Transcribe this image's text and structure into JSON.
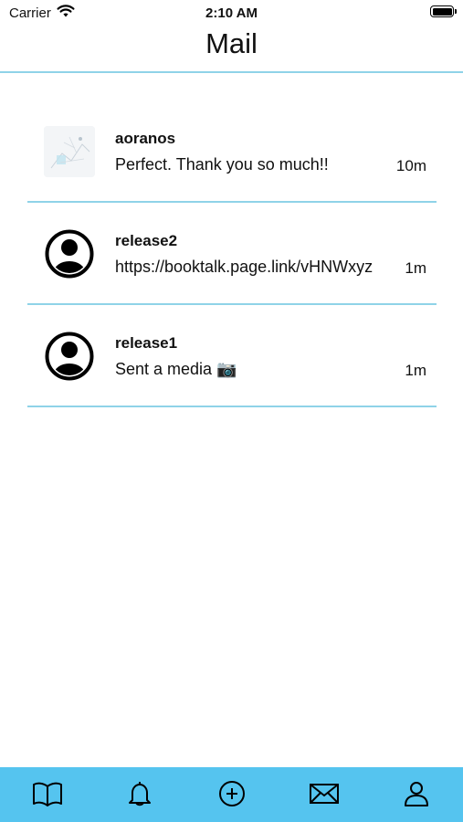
{
  "status_bar": {
    "carrier": "Carrier",
    "time": "2:10 AM"
  },
  "header": {
    "title": "Mail"
  },
  "conversations": [
    {
      "name": "aoranos",
      "preview": "Perfect. Thank you so much!!",
      "time": "10m",
      "avatar": "photo"
    },
    {
      "name": "release2",
      "preview": "https://booktalk.page.link/vHNWxyz",
      "time": "1m",
      "avatar": "default-user-icon"
    },
    {
      "name": "release1",
      "preview": "Sent a media 📷",
      "time": "1m",
      "avatar": "default-user-icon"
    }
  ],
  "tab_bar": {
    "background": "#55c4ef",
    "tabs": [
      "book-icon",
      "bell-icon",
      "plus-circle-icon",
      "mail-icon",
      "user-icon"
    ]
  },
  "colors": {
    "divider": "#8fd3e8"
  }
}
